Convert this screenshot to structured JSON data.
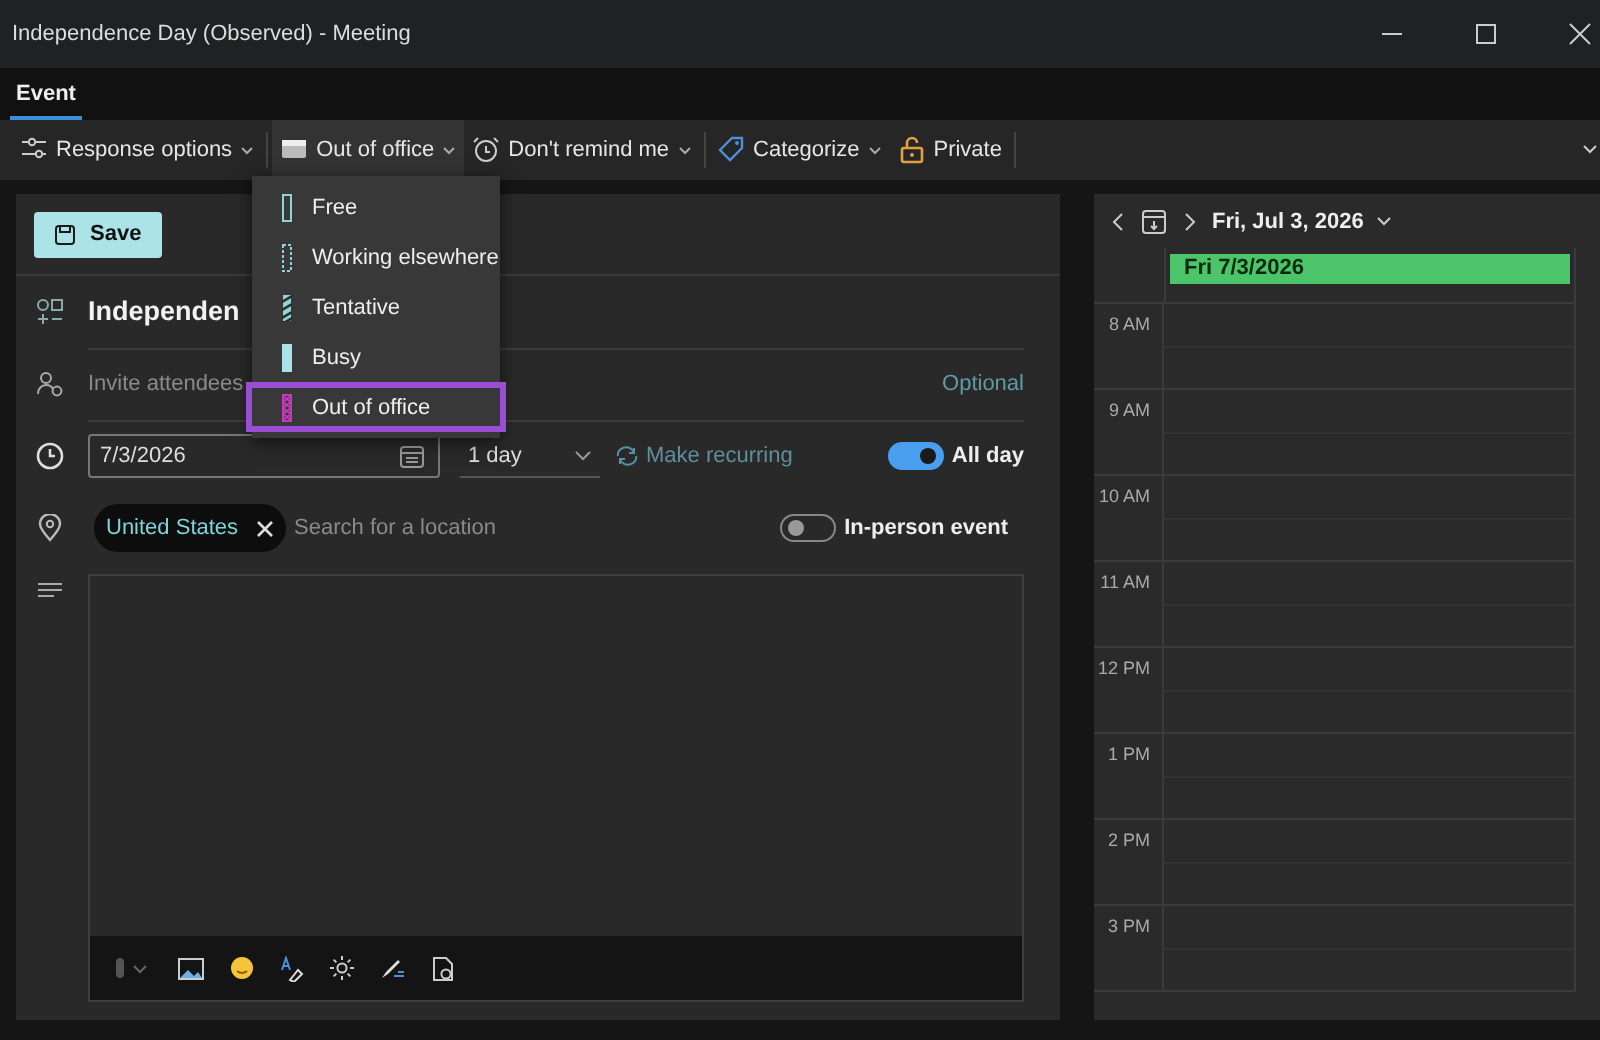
{
  "window": {
    "title": "Independence Day (Observed) - Meeting"
  },
  "tabs": [
    {
      "label": "Event",
      "selected": true
    }
  ],
  "toolbar": [
    {
      "kind": "response",
      "label": "Response options",
      "caret": true
    },
    {
      "kind": "status",
      "label": "Out of office",
      "caret": true,
      "expanded": true
    },
    {
      "kind": "reminder",
      "label": "Don't remind me",
      "caret": true
    },
    {
      "kind": "categorize",
      "label": "Categorize",
      "caret": true
    },
    {
      "kind": "private",
      "label": "Private",
      "caret": false
    }
  ],
  "status_menu": [
    {
      "kind": "free",
      "label": "Free",
      "selected": false
    },
    {
      "kind": "elsewhere",
      "label": "Working elsewhere",
      "selected": false
    },
    {
      "kind": "tentative",
      "label": "Tentative",
      "selected": false
    },
    {
      "kind": "busy",
      "label": "Busy",
      "selected": false
    },
    {
      "kind": "oof",
      "label": "Out of office",
      "selected": true
    }
  ],
  "editor": {
    "save": "Save",
    "title": "Independen",
    "attendees_placeholder": "Invite attendees",
    "optional": "Optional",
    "date": "7/3/2026",
    "duration": "1 day",
    "recurring": "Make recurring",
    "all_day": {
      "label": "All day",
      "on": true
    },
    "location_chip": "United States",
    "location_placeholder": "Search for a location",
    "in_person": {
      "label": "In-person event",
      "on": false
    }
  },
  "calendar": {
    "date_label": "Fri, Jul 3, 2026",
    "all_day_event": "Fri 7/3/2026",
    "hours": [
      "8 AM",
      "9 AM",
      "10 AM",
      "11 AM",
      "12 PM",
      "1 PM",
      "2 PM",
      "3 PM"
    ]
  }
}
